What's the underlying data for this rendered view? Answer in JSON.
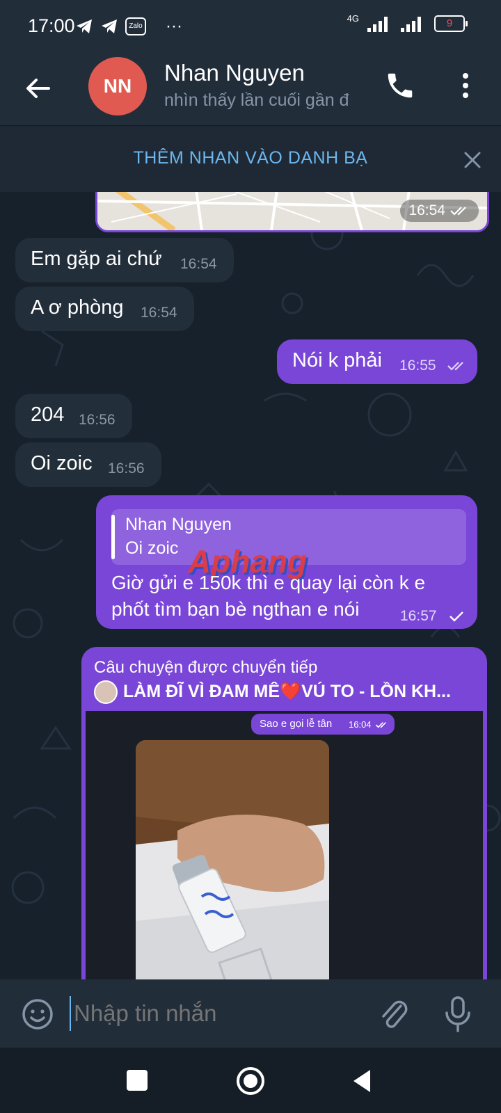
{
  "status_bar": {
    "time": "17:00",
    "network": "4G",
    "battery": "9",
    "app_icons": [
      "telegram-icon",
      "telegram-icon",
      "zalo-icon"
    ],
    "zalo_label": "Zalo",
    "more": "···"
  },
  "header": {
    "avatar_initials": "NN",
    "name": "Nhan Nguyen",
    "last_seen": "nhìn thấy lần cuối gần đ"
  },
  "banner": {
    "text": "THÊM NHAN VÀO DANH BẠ"
  },
  "messages": [
    {
      "dir": "out",
      "kind": "location",
      "time": "16:54",
      "status": "read"
    },
    {
      "dir": "in",
      "text": "Em gặp ai chứ",
      "time": "16:54"
    },
    {
      "dir": "in",
      "text": "A ơ phòng",
      "time": "16:54"
    },
    {
      "dir": "out",
      "text": "Nói k phải",
      "time": "16:55",
      "status": "read"
    },
    {
      "dir": "in",
      "text": "204",
      "time": "16:56"
    },
    {
      "dir": "in",
      "text": "Oi zoic",
      "time": "16:56"
    },
    {
      "dir": "out",
      "reply_to": {
        "name": "Nhan Nguyen",
        "text": "Oi zoic"
      },
      "lines": [
        "Giờ gửi e 150k thì e quay lại còn k e",
        "phốt tìm bạn bè ngthan e nói"
      ],
      "time": "16:57",
      "status": "sent"
    },
    {
      "dir": "out",
      "kind": "forwarded",
      "forward_label": "Câu chuyện được chuyển tiếp",
      "source": "LÀM ĐĨ VÌ ĐAM MÊ❤️VÚ TO - LỒN KH...",
      "inner_text": "Sao e gọi lễ tân",
      "inner_time": "16:04"
    }
  ],
  "watermark": "Aphang",
  "input": {
    "placeholder": "Nhập tin nhắn"
  },
  "colors": {
    "outgoing": "#7a46d8",
    "incoming": "#232e3b",
    "accent": "#6cb7f0",
    "avatar": "#e05a52"
  }
}
